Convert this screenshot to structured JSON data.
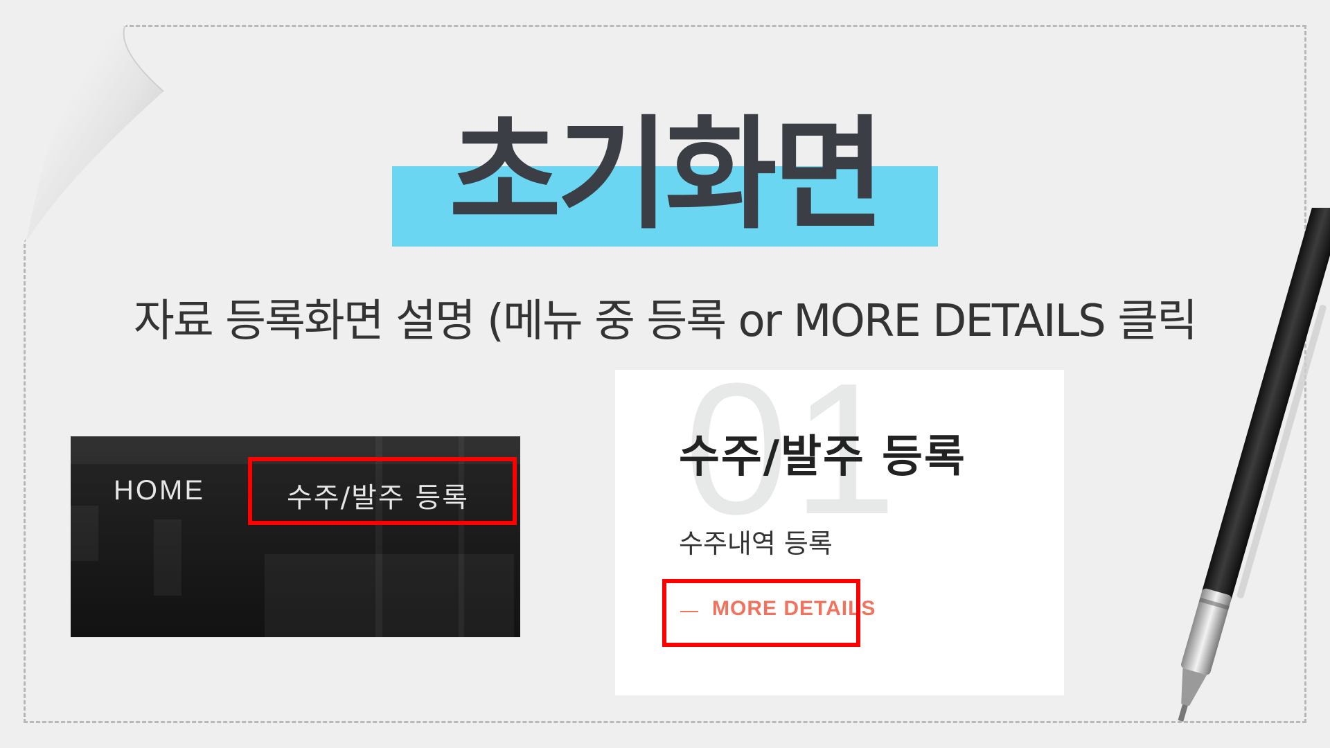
{
  "slide": {
    "title": "초기화면",
    "subtitle": "자료 등록화면 설명 (메뉴 중 등록 or MORE DETAILS 클릭",
    "colors": {
      "background": "#efefef",
      "title_highlight": "#6ad6f2",
      "title_text": "#3b3e44",
      "callout_border": "#ff0000",
      "accent": "#f0735e"
    }
  },
  "nav_screenshot": {
    "items": [
      {
        "label": "HOME"
      },
      {
        "label": "수주/발주 등록"
      }
    ]
  },
  "card_screenshot": {
    "number": "01",
    "title": "수주/발주 등록",
    "description": "수주내역 등록",
    "more_label": "MORE DETAILS"
  }
}
